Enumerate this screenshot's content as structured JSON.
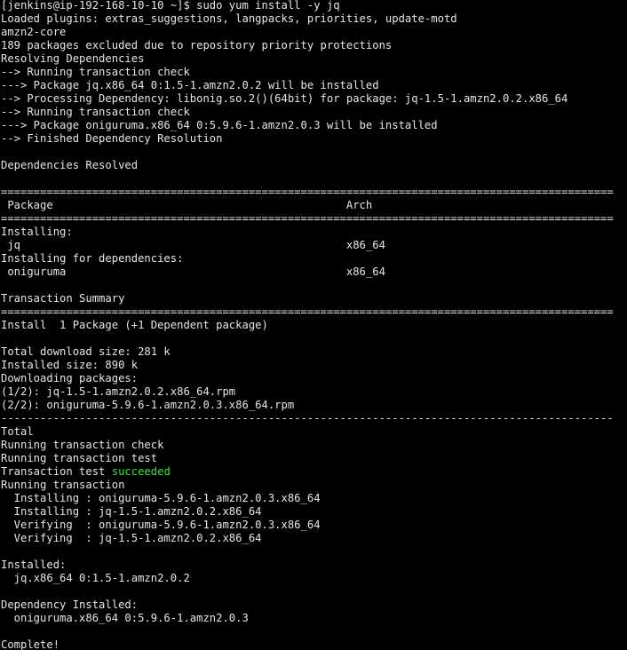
{
  "terminal": {
    "lines": [
      {
        "t": "[jenkins@ip-192-168-10-10 ~]$ sudo yum install -y jq"
      },
      {
        "t": "Loaded plugins: extras_suggestions, langpacks, priorities, update-motd"
      },
      {
        "t": "amzn2-core"
      },
      {
        "t": "189 packages excluded due to repository priority protections"
      },
      {
        "t": "Resolving Dependencies"
      },
      {
        "t": "--> Running transaction check"
      },
      {
        "t": "---> Package jq.x86_64 0:1.5-1.amzn2.0.2 will be installed"
      },
      {
        "t": "--> Processing Dependency: libonig.so.2()(64bit) for package: jq-1.5-1.amzn2.0.2.x86_64"
      },
      {
        "t": "--> Running transaction check"
      },
      {
        "t": "---> Package oniguruma.x86_64 0:5.9.6-1.amzn2.0.3 will be installed"
      },
      {
        "t": "--> Finished Dependency Resolution"
      },
      {
        "t": ""
      },
      {
        "t": "Dependencies Resolved"
      },
      {
        "t": ""
      },
      {
        "t": "=============================================================================================="
      },
      {
        "t": " Package                                             Arch"
      },
      {
        "t": "=============================================================================================="
      },
      {
        "t": "Installing:"
      },
      {
        "t": " jq                                                  x86_64"
      },
      {
        "t": "Installing for dependencies:"
      },
      {
        "t": " oniguruma                                           x86_64"
      },
      {
        "t": ""
      },
      {
        "t": "Transaction Summary"
      },
      {
        "t": "=============================================================================================="
      },
      {
        "t": "Install  1 Package (+1 Dependent package)"
      },
      {
        "t": ""
      },
      {
        "t": "Total download size: 281 k"
      },
      {
        "t": "Installed size: 890 k"
      },
      {
        "t": "Downloading packages:"
      },
      {
        "t": "(1/2): jq-1.5-1.amzn2.0.2.x86_64.rpm"
      },
      {
        "t": "(2/2): oniguruma-5.9.6-1.amzn2.0.3.x86_64.rpm"
      },
      {
        "t": "----------------------------------------------------------------------------------------------"
      },
      {
        "t": "Total"
      },
      {
        "t": "Running transaction check"
      },
      {
        "t": "Running transaction test"
      },
      {
        "t": "Transaction test ",
        "hl": "succeeded"
      },
      {
        "t": "Running transaction"
      },
      {
        "t": "  Installing : oniguruma-5.9.6-1.amzn2.0.3.x86_64"
      },
      {
        "t": "  Installing : jq-1.5-1.amzn2.0.2.x86_64"
      },
      {
        "t": "  Verifying  : oniguruma-5.9.6-1.amzn2.0.3.x86_64"
      },
      {
        "t": "  Verifying  : jq-1.5-1.amzn2.0.2.x86_64"
      },
      {
        "t": ""
      },
      {
        "t": "Installed:"
      },
      {
        "t": "  jq.x86_64 0:1.5-1.amzn2.0.2"
      },
      {
        "t": ""
      },
      {
        "t": "Dependency Installed:"
      },
      {
        "t": "  oniguruma.x86_64 0:5.9.6-1.amzn2.0.3"
      },
      {
        "t": ""
      },
      {
        "t": "Complete!"
      }
    ]
  },
  "colors": {
    "background": "#000000",
    "text": "#e5e5e5",
    "success": "#34e234"
  }
}
